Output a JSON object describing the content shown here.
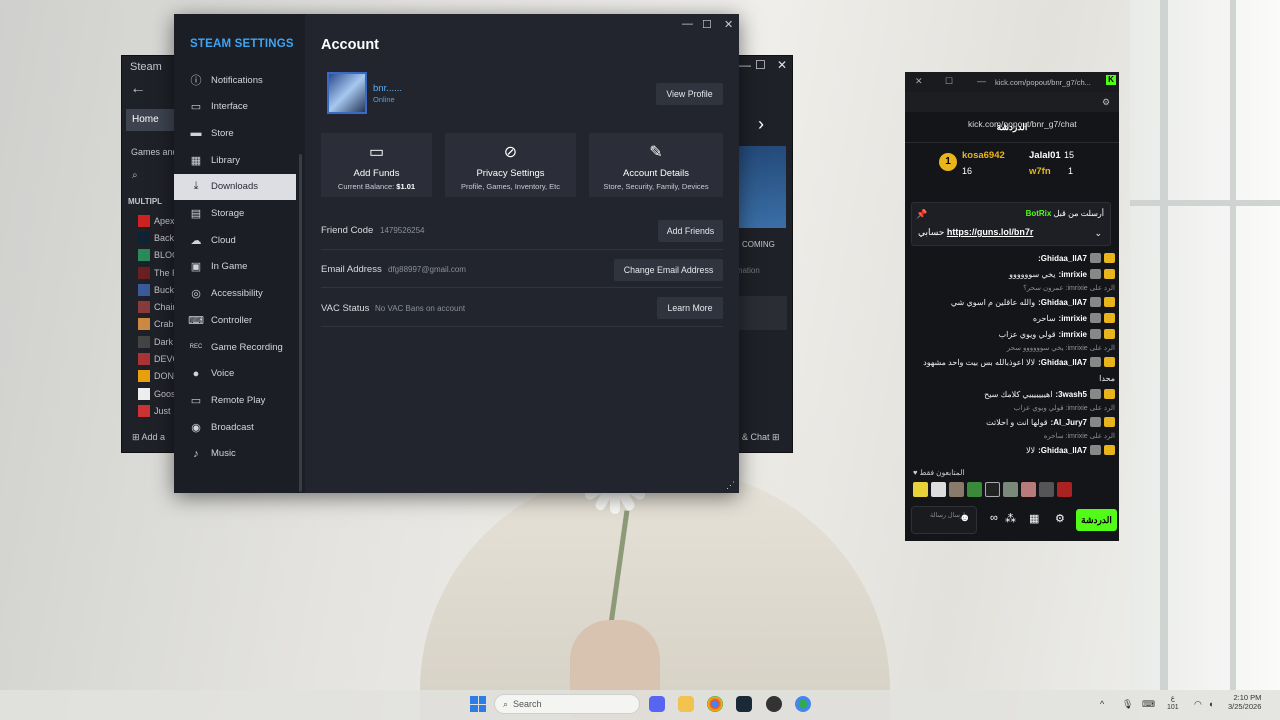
{
  "back_window": {
    "title": "Steam",
    "home": "Home",
    "games_and": "Games and",
    "section": "MULTIPL",
    "games": [
      "Apex",
      "Back",
      "BLOC",
      "The R",
      "Buck",
      "Chair",
      "Crab",
      "Dark",
      "DEVO",
      "DON",
      "Goos",
      "Just"
    ],
    "add": "Add a",
    "coming": "COMING",
    "nation": "nation",
    "chat": "& Chat"
  },
  "settings": {
    "heading": "STEAM SETTINGS",
    "nav": [
      {
        "label": "Notifications",
        "icon": "ⓘ"
      },
      {
        "label": "Interface",
        "icon": "▭"
      },
      {
        "label": "Store",
        "icon": "▬"
      },
      {
        "label": "Library",
        "icon": "▦"
      },
      {
        "label": "Downloads",
        "icon": "⤓"
      },
      {
        "label": "Storage",
        "icon": "▤"
      },
      {
        "label": "Cloud",
        "icon": "☁"
      },
      {
        "label": "In Game",
        "icon": "▣"
      },
      {
        "label": "Accessibility",
        "icon": "◎"
      },
      {
        "label": "Controller",
        "icon": "⌨"
      },
      {
        "label": "Game Recording",
        "icon": "REC"
      },
      {
        "label": "Voice",
        "icon": "●"
      },
      {
        "label": "Remote Play",
        "icon": "▭"
      },
      {
        "label": "Broadcast",
        "icon": "◉"
      },
      {
        "label": "Music",
        "icon": "♪"
      }
    ],
    "active_index": 4,
    "page_title": "Account",
    "user": {
      "name": "bnr......",
      "status": "Online"
    },
    "view_profile": "View Profile",
    "cards": [
      {
        "title": "Add Funds",
        "sub": "Current Balance:",
        "extra": "$1.01",
        "icon": "▭"
      },
      {
        "title": "Privacy Settings",
        "sub": "Profile, Games, Inventory, Etc",
        "extra": "",
        "icon": "◎"
      },
      {
        "title": "Account Details",
        "sub": "Store, Security, Family, Devices",
        "extra": "",
        "icon": "✎"
      }
    ],
    "rows": [
      {
        "label": "Friend Code",
        "value": "1479526254",
        "button": "Add Friends"
      },
      {
        "label": "Email Address",
        "value": "dfg88997@gmail.com",
        "button": "Change Email Address"
      },
      {
        "label": "VAC Status",
        "value": "No VAC Bans on account",
        "button": "Learn More"
      }
    ]
  },
  "kick": {
    "url": "kick.com/popout/bnr_g7/ch...",
    "url_full": "kick.com/popout/bnr_g7/chat",
    "title": "الدردشة",
    "leaders": [
      {
        "name": "kosa6942",
        "count": "16"
      },
      {
        "name": "Jalal01",
        "count": "15"
      },
      {
        "name": "w7fn",
        "count": "1"
      }
    ],
    "pinned_by": "أرسلت من قبل",
    "pinned_user": "BotRix",
    "pinned_text": "حسابي",
    "pinned_link": "https://guns.lol/bn7r",
    "messages": [
      {
        "user": "Ghidaa_llA7:",
        "text": "",
        "reply": false
      },
      {
        "user": "imrixie:",
        "text": "يخي سوووووو",
        "reply": false
      },
      {
        "user": "",
        "text": "الرد على imrixie: عمرون سحر؟",
        "reply": true
      },
      {
        "user": "Ghidaa_llA7:",
        "text": "والله عاقلين م اسوي شي",
        "reply": false
      },
      {
        "user": "imrixie:",
        "text": "ساحره",
        "reply": false
      },
      {
        "user": "imrixie:",
        "text": "قولي ويوي عزاب",
        "reply": false
      },
      {
        "user": "",
        "text": "الرد على imrixie: يخي سوووووو سحر",
        "reply": true
      },
      {
        "user": "Ghidaa_llA7:",
        "text": "لالا اعوذبالله بس بيت واحد مشهود",
        "reply": false
      },
      {
        "user": "",
        "text": "محدا",
        "reply": false
      },
      {
        "user": "3wash5:",
        "text": "اهيييييييي كلامك سيح",
        "reply": false
      },
      {
        "user": "",
        "text": "الرد على imrixie: قولي ويوي عزاب",
        "reply": true
      },
      {
        "user": "Al_Jury7:",
        "text": "قولها انت و احلاتت",
        "reply": false
      },
      {
        "user": "",
        "text": "الرد على imrixie: ساحره",
        "reply": true
      },
      {
        "user": "Ghidaa_llA7:",
        "text": "لالا",
        "reply": false
      }
    ],
    "followers": "المتابعون فقط",
    "send": "الدردشة",
    "input_hint": "إرسال رسالة"
  },
  "taskbar": {
    "search": "Search",
    "time": "2:10 PM",
    "date": "3/25/2026",
    "lang_top": "ع",
    "lang_bottom": "101"
  }
}
